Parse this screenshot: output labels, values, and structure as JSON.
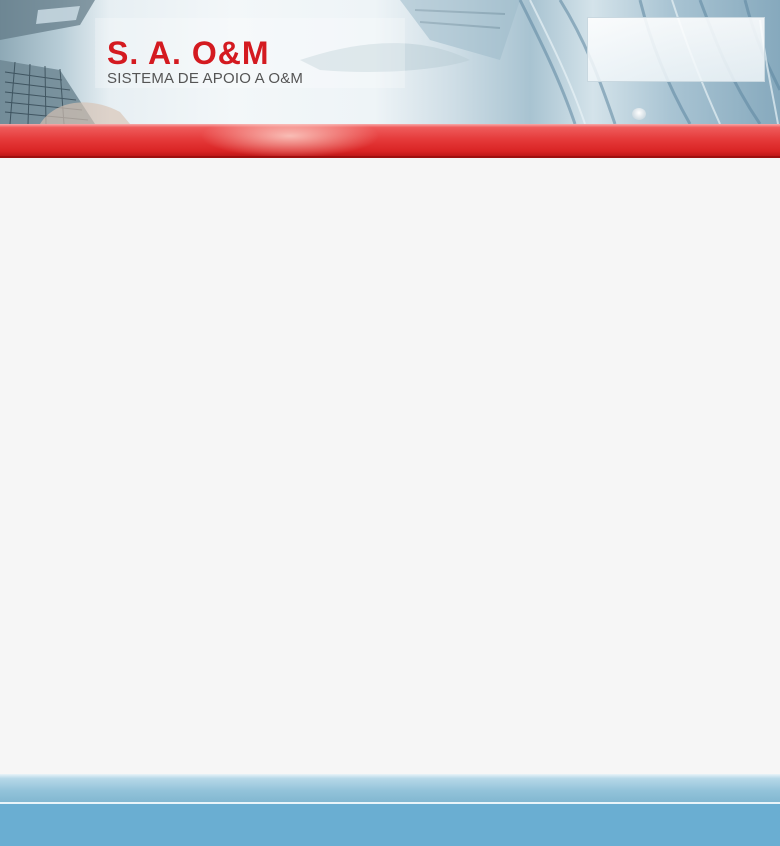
{
  "header": {
    "title": "S. A. O&M",
    "subtitle": "SISTEMA DE APOIO A O&M",
    "title_color": "#d41a20",
    "subtitle_color": "#555555"
  },
  "nav": {
    "color": "#e53a3a"
  },
  "content": {
    "background": "#f6f6f6"
  },
  "footer": {
    "color": "#6aaed2"
  }
}
